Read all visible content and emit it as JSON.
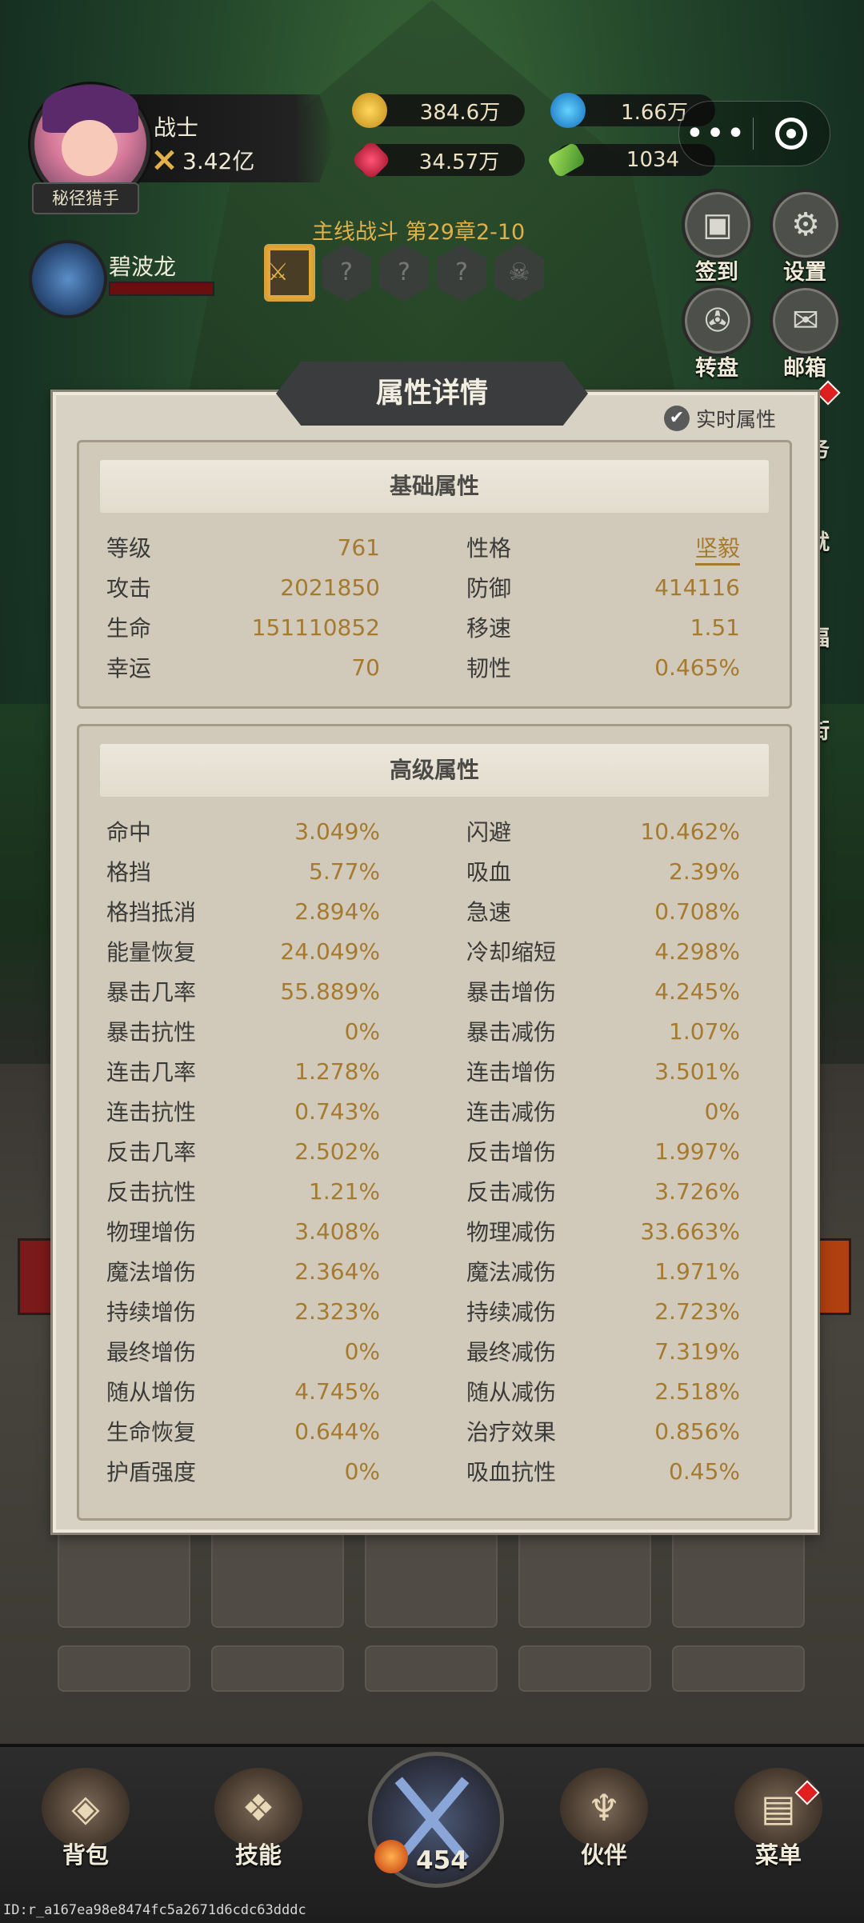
{
  "hud": {
    "hero_class": "战士",
    "hero_power": "3.42亿",
    "hero_title": "秘径猎手",
    "currencies": {
      "gold": "384.6万",
      "diamond": "1.66万",
      "ruby": "34.57万",
      "ticket": "1034"
    },
    "capsule_more": "•••",
    "stage_title": "主线战斗 第29章2-10",
    "stage_nodes": [
      "✿",
      "⚔",
      "?",
      "?",
      "?",
      "☠"
    ],
    "pet_name": "碧波龙"
  },
  "side_buttons": {
    "signin": "签到",
    "settings": "设置",
    "wheel": "转盘",
    "mail": "邮箱",
    "partial_1": "务",
    "partial_2": "就",
    "partial_3": "福",
    "partial_4": "街"
  },
  "panel": {
    "title": "属性详情",
    "realtime_label": "实时属性",
    "basic": {
      "header": "基础属性",
      "rows": [
        [
          "等级",
          "761",
          "性格",
          "坚毅"
        ],
        [
          "攻击",
          "2021850",
          "防御",
          "414116"
        ],
        [
          "生命",
          "151110852",
          "移速",
          "1.51"
        ],
        [
          "幸运",
          "70",
          "韧性",
          "0.465%"
        ]
      ]
    },
    "advanced": {
      "header": "高级属性",
      "rows": [
        [
          "命中",
          "3.049%",
          "闪避",
          "10.462%"
        ],
        [
          "格挡",
          "5.77%",
          "吸血",
          "2.39%"
        ],
        [
          "格挡抵消",
          "2.894%",
          "急速",
          "0.708%"
        ],
        [
          "能量恢复",
          "24.049%",
          "冷却缩短",
          "4.298%"
        ],
        [
          "暴击几率",
          "55.889%",
          "暴击增伤",
          "4.245%"
        ],
        [
          "暴击抗性",
          "0%",
          "暴击减伤",
          "1.07%"
        ],
        [
          "连击几率",
          "1.278%",
          "连击增伤",
          "3.501%"
        ],
        [
          "连击抗性",
          "0.743%",
          "连击减伤",
          "0%"
        ],
        [
          "反击几率",
          "2.502%",
          "反击增伤",
          "1.997%"
        ],
        [
          "反击抗性",
          "1.21%",
          "反击减伤",
          "3.726%"
        ],
        [
          "物理增伤",
          "3.408%",
          "物理减伤",
          "33.663%"
        ],
        [
          "魔法增伤",
          "2.364%",
          "魔法减伤",
          "1.971%"
        ],
        [
          "持续增伤",
          "2.323%",
          "持续减伤",
          "2.723%"
        ],
        [
          "最终增伤",
          "0%",
          "最终减伤",
          "7.319%"
        ],
        [
          "随从增伤",
          "4.745%",
          "随从减伤",
          "2.518%"
        ],
        [
          "生命恢复",
          "0.644%",
          "治疗效果",
          "0.856%"
        ],
        [
          "护盾强度",
          "0%",
          "吸血抗性",
          "0.45%"
        ]
      ]
    }
  },
  "nav": {
    "bag": "背包",
    "skills": "技能",
    "battle_count": "454",
    "partner": "伙伴",
    "menu": "菜单"
  },
  "footer_id": "ID:r_a167ea98e8474fc5a2671d6cdc63dddc",
  "icons": [
    "gold-coin-icon",
    "blue-gem-icon",
    "red-gem-icon",
    "ticket-icon",
    "calendar-icon",
    "gear-icon",
    "wheel-icon",
    "mail-icon",
    "sword-icon"
  ]
}
